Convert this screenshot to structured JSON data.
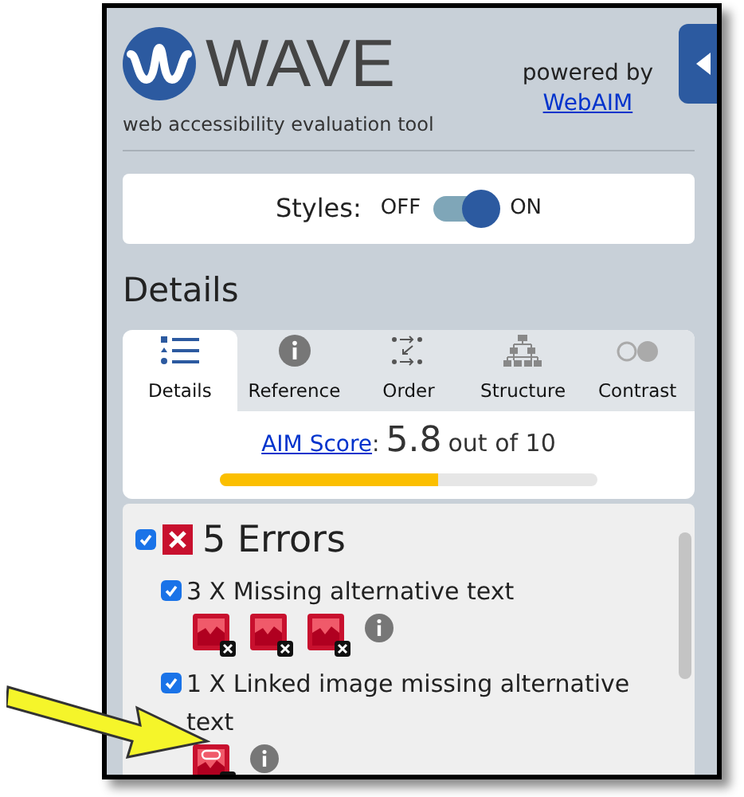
{
  "app": {
    "name": "WAVE",
    "tagline": "web accessibility evaluation tool",
    "powered_by": "powered by",
    "powered_link": "WebAIM"
  },
  "styles_toggle": {
    "label": "Styles:",
    "off_label": "OFF",
    "on_label": "ON",
    "on": true
  },
  "heading": "Details",
  "tabs": [
    {
      "label": "Details",
      "selected": true
    },
    {
      "label": "Reference",
      "selected": false
    },
    {
      "label": "Order",
      "selected": false
    },
    {
      "label": "Structure",
      "selected": false
    },
    {
      "label": "Contrast",
      "selected": false
    }
  ],
  "aim_score": {
    "link": "AIM Score",
    "separator": ":",
    "score": "5.8",
    "suffix": "out of 10",
    "level": 0.58
  },
  "errors": {
    "checked": true,
    "title": "5 Errors",
    "items": [
      {
        "checked": true,
        "label": "3 X Missing alternative text",
        "icons": [
          {
            "kind": "missing-alt"
          },
          {
            "kind": "missing-alt"
          },
          {
            "kind": "missing-alt"
          }
        ]
      },
      {
        "checked": true,
        "label": "1 X Linked image missing alternative text",
        "icons": [
          {
            "kind": "linked-missing-alt"
          }
        ]
      }
    ]
  }
}
